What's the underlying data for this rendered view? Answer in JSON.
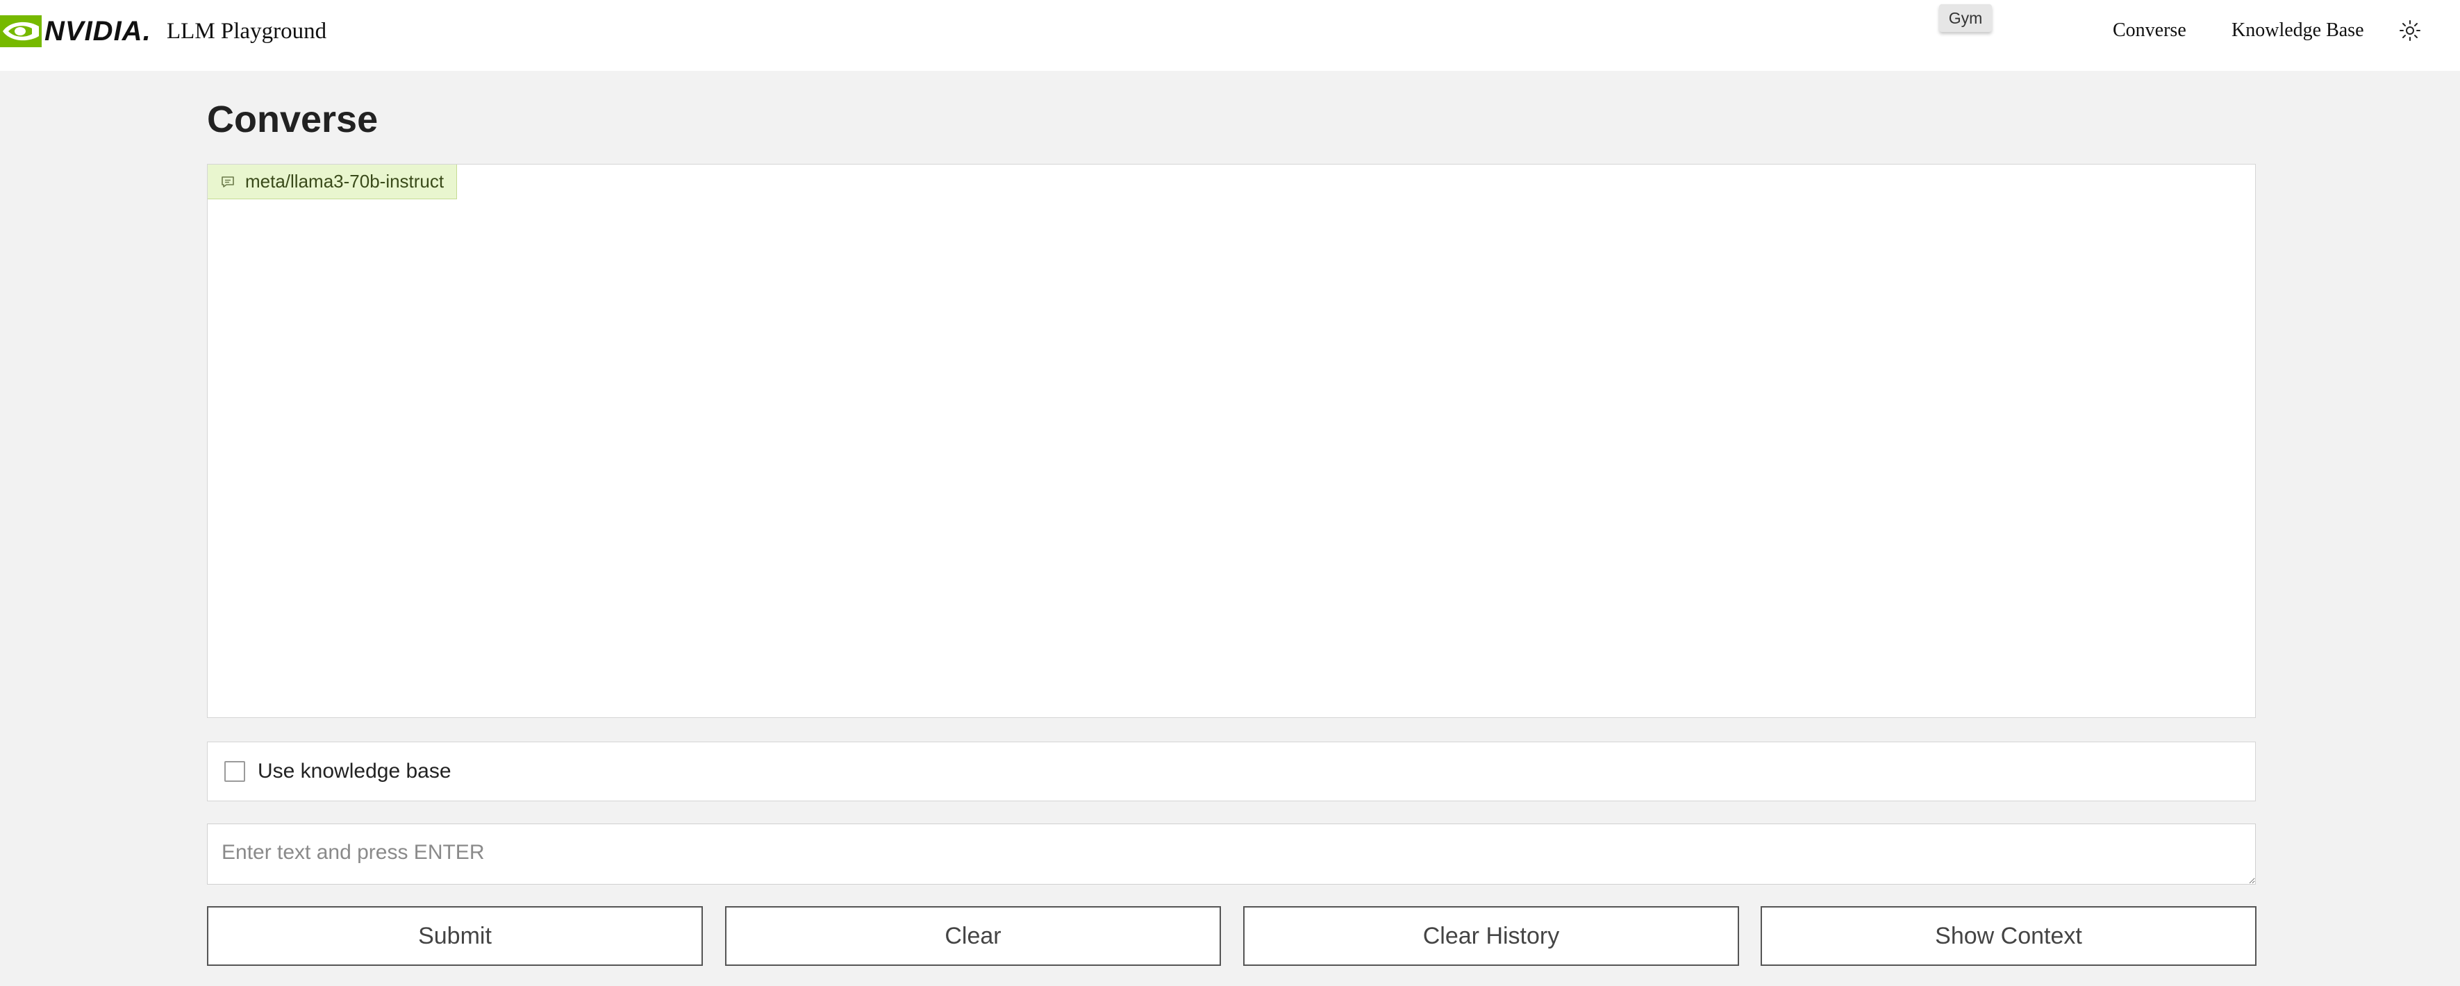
{
  "header": {
    "brand": "NVIDIA.",
    "app_title": "LLM Playground",
    "gym_badge": "Gym",
    "nav": [
      {
        "label": "Converse"
      },
      {
        "label": "Knowledge Base"
      }
    ],
    "theme_icon": "sun-icon"
  },
  "main": {
    "page_title": "Converse",
    "chat": {
      "model_icon": "chat-bubble-icon",
      "model_name": "meta/llama3-70b-instruct"
    },
    "knowledge_base": {
      "label": "Use knowledge base",
      "checked": false
    },
    "input": {
      "value": "",
      "placeholder": "Enter text and press ENTER"
    },
    "buttons": {
      "submit": "Submit",
      "clear": "Clear",
      "clear_history": "Clear History",
      "show_context": "Show Context"
    }
  },
  "colors": {
    "brand_green": "#76b900",
    "chip_background": "#e9f6cf",
    "page_background": "#f2f2f2"
  }
}
